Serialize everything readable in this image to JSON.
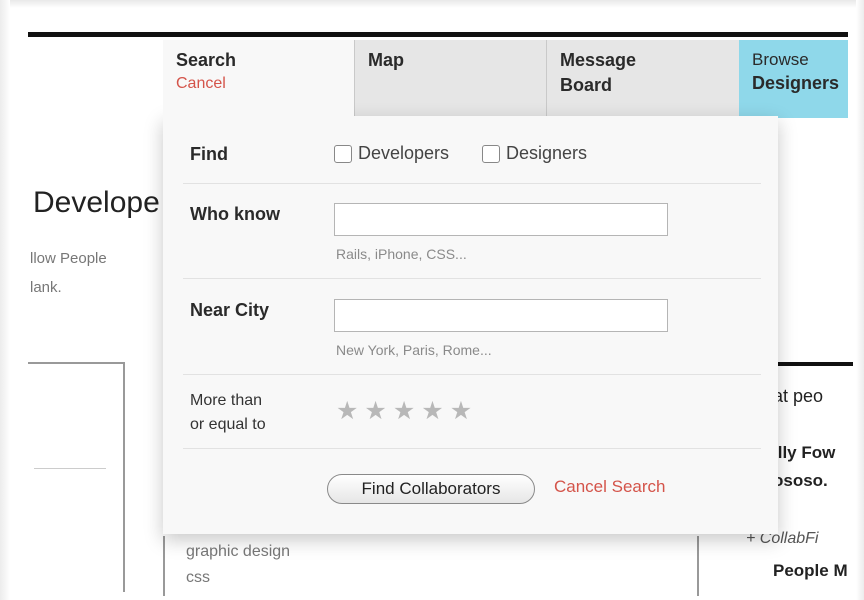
{
  "tabs": {
    "search": {
      "label": "Search",
      "cancel": "Cancel"
    },
    "map": {
      "label": "Map"
    },
    "message_board": {
      "label": "Message Board"
    },
    "browse": {
      "line1": "Browse",
      "line2": "Designers"
    }
  },
  "form": {
    "find": {
      "label": "Find",
      "options": [
        {
          "label": "Developers",
          "checked": false
        },
        {
          "label": "Designers",
          "checked": false
        }
      ]
    },
    "who_know": {
      "label": "Who know",
      "value": "",
      "hint": "Rails, iPhone, CSS..."
    },
    "near_city": {
      "label": "Near City",
      "value": "",
      "hint": "New York, Paris, Rome..."
    },
    "rating": {
      "label_line1": "More than",
      "label_line2": "or equal to",
      "stars_total": 5,
      "stars_selected": 0
    },
    "submit_label": "Find Collaborators",
    "cancel_label": "Cancel Search"
  },
  "background": {
    "heading": "Develope",
    "text_line1": "llow People",
    "text_line2": "lank.",
    "mid_text_line1": "graphic design",
    "mid_text_line2": "css",
    "right_heading": "at peo",
    "right_line1": "illy Fow",
    "right_line2": "ososo.",
    "right_italic": "+ CollabFi",
    "right_line3": "People M"
  },
  "colors": {
    "accent_red": "#d4544a",
    "tab_highlight": "#8fd8ea",
    "panel_bg": "#f8f8f8"
  }
}
